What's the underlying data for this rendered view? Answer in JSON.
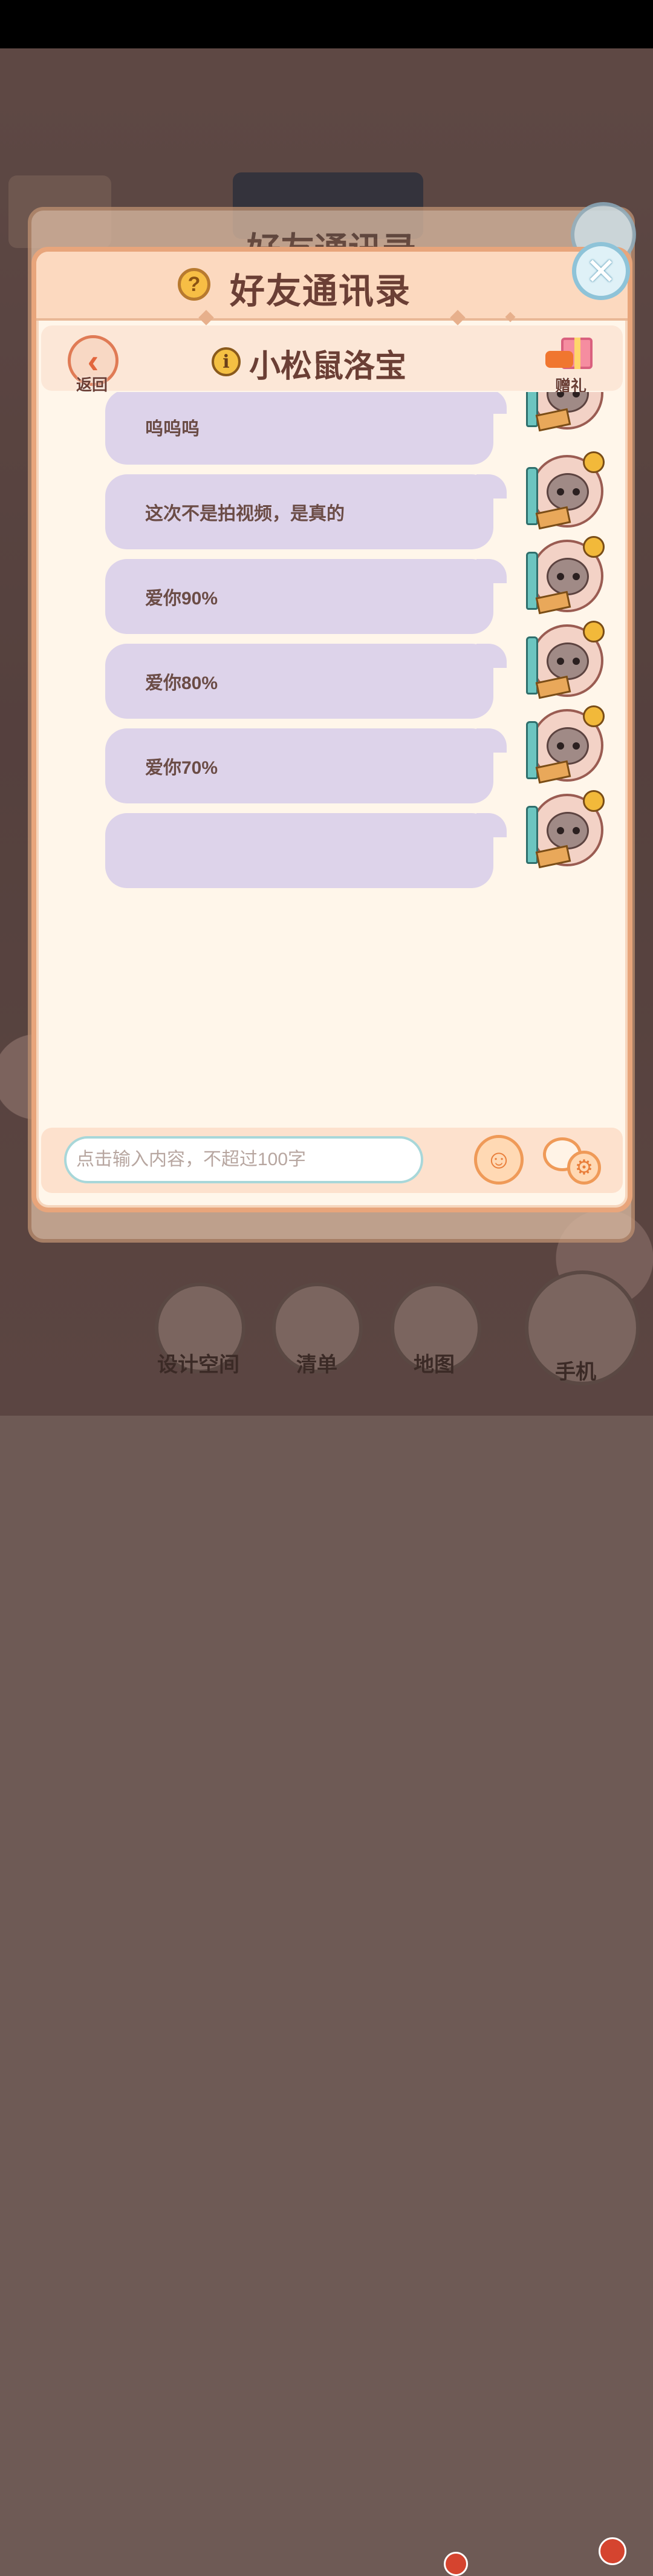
{
  "dialog": {
    "title": "好友通讯录",
    "ghost_title": "好友通讯录",
    "help_icon": "question-icon",
    "close_icon": "close-icon"
  },
  "contact": {
    "name": "小松鼠洛宝",
    "back_label": "返回",
    "gift_label": "赠礼"
  },
  "messages": [
    {
      "text": "呜呜呜"
    },
    {
      "text": "这次不是拍视频，是真的"
    },
    {
      "text": "爱你90%"
    },
    {
      "text": "爱你80%"
    },
    {
      "text": "爱你70%"
    },
    {
      "text": ""
    }
  ],
  "input": {
    "placeholder": "点击输入内容，不超过100字"
  },
  "bottom_nav": {
    "items": [
      {
        "label": "设计空间"
      },
      {
        "label": "清单"
      },
      {
        "label": "地图"
      },
      {
        "label": "手机"
      }
    ]
  },
  "colors": {
    "bubble": "#ddd3ea",
    "header": "#fcd9bf",
    "dialog_border": "#e8a57b",
    "title_text": "#6b3f35"
  }
}
